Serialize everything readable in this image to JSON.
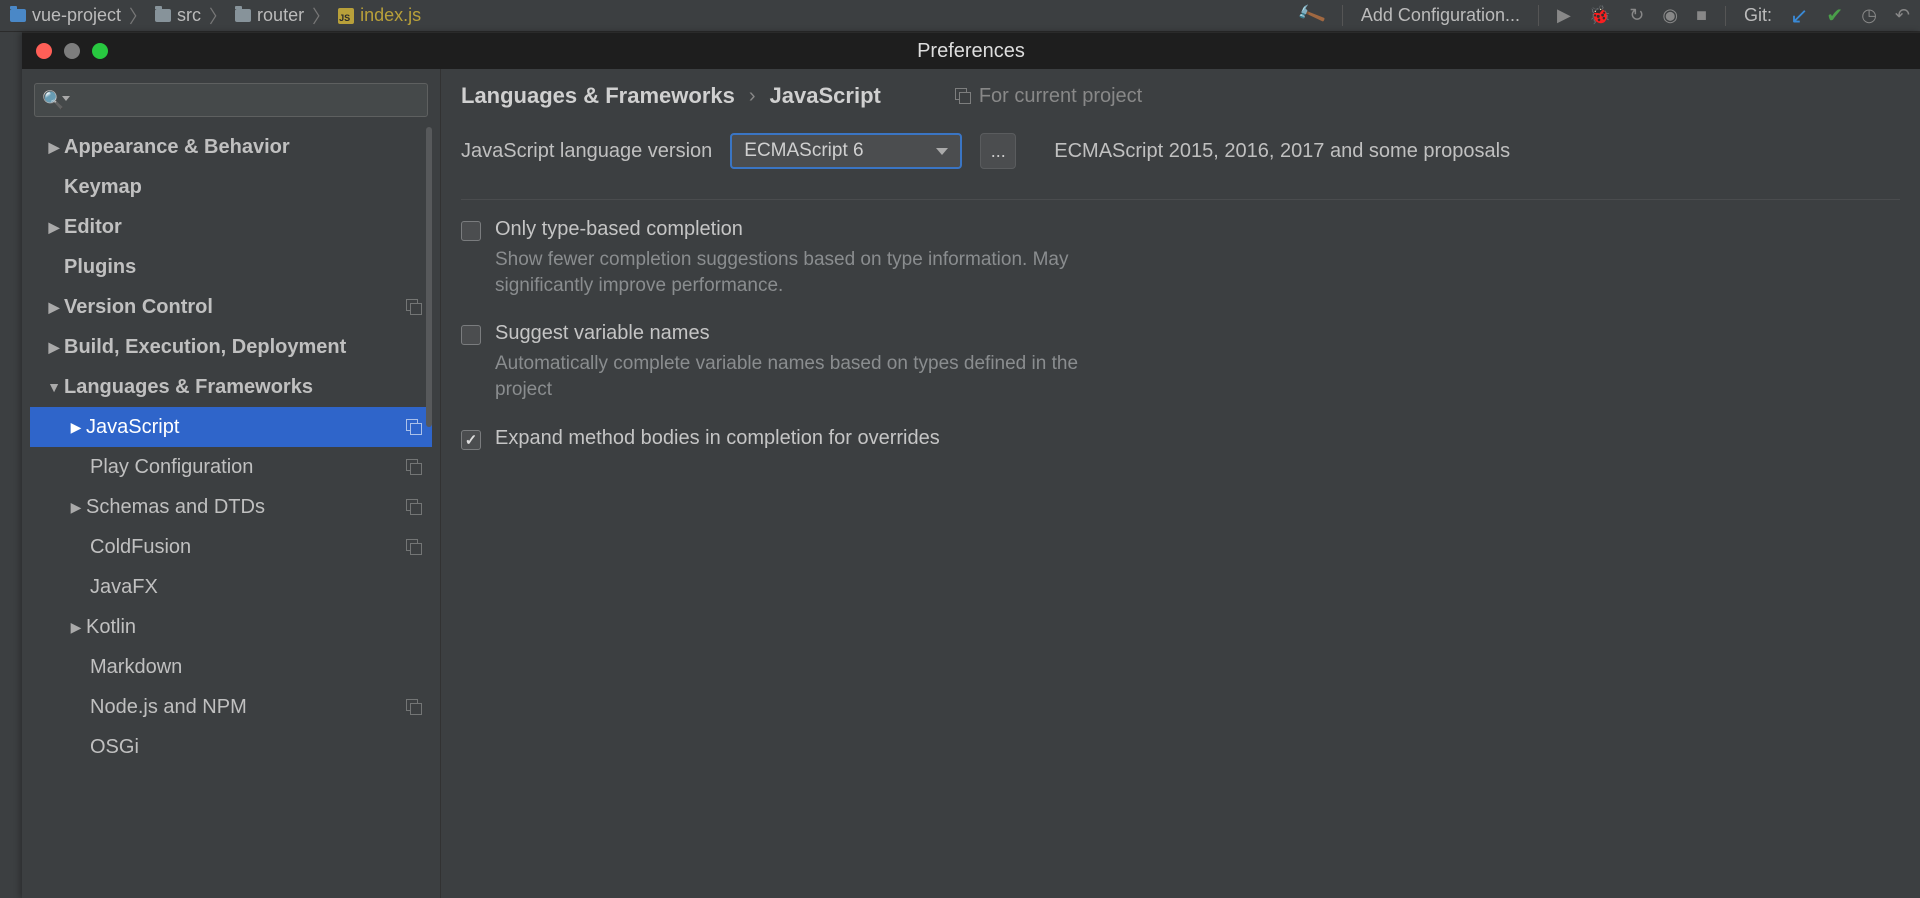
{
  "ide": {
    "breadcrumbs": [
      "vue-project",
      "src",
      "router",
      "index.js"
    ],
    "addConfiguration": "Add Configuration...",
    "gitLabel": "Git:"
  },
  "dialog": {
    "title": "Preferences",
    "searchPlaceholder": "",
    "tree": {
      "appearance": "Appearance & Behavior",
      "keymap": "Keymap",
      "editor": "Editor",
      "plugins": "Plugins",
      "vcs": "Version Control",
      "build": "Build, Execution, Deployment",
      "lang": "Languages & Frameworks",
      "javascript": "JavaScript",
      "play": "Play Configuration",
      "schemas": "Schemas and DTDs",
      "coldfusion": "ColdFusion",
      "javafx": "JavaFX",
      "kotlin": "Kotlin",
      "markdown": "Markdown",
      "node": "Node.js and NPM",
      "osgi": "OSGi"
    },
    "main": {
      "bc1": "Languages & Frameworks",
      "bc2": "JavaScript",
      "scope": "For current project",
      "langVersionLabel": "JavaScript language version",
      "langVersionValue": "ECMAScript 6",
      "ellipsis": "...",
      "langVersionHint": "ECMAScript 2015, 2016, 2017 and some proposals",
      "opt1_title": "Only type-based completion",
      "opt1_sub": "Show fewer completion suggestions based on type information. May significantly improve performance.",
      "opt2_title": "Suggest variable names",
      "opt2_sub": "Automatically complete variable names based on types defined in the project",
      "opt3_title": "Expand method bodies in completion for overrides"
    }
  }
}
